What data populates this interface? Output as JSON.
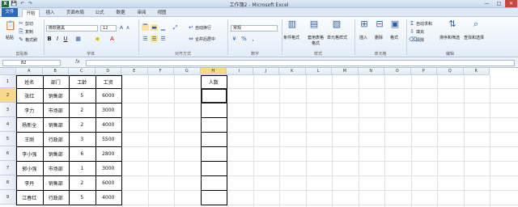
{
  "window": {
    "title": "工作簿2 - Microsoft Excel",
    "min": "—",
    "max": "□",
    "close": "✕"
  },
  "quick_access": {
    "save": "💾",
    "undo": "↶",
    "redo": "↷"
  },
  "menu": {
    "file": "文件",
    "tabs": [
      "开始",
      "插入",
      "页面布局",
      "公式",
      "数据",
      "审阅",
      "视图"
    ]
  },
  "ribbon": {
    "paste": "粘贴",
    "cut": "剪切",
    "copy": "复制",
    "format_painter": "格式刷",
    "clipboard_label": "剪贴板",
    "font_name": "微软雅黑",
    "font_size": "12",
    "bold": "B",
    "italic": "I",
    "underline": "U",
    "font_label": "字体",
    "wrap_text": "自动换行",
    "merge_center": "合并后居中",
    "alignment_label": "对齐方式",
    "number_format": "常规",
    "percent": "%",
    "comma": ",",
    "number_label": "数字",
    "conditional_format": "条件格式",
    "format_as_table": "套用表格格式",
    "cell_styles": "单元格样式",
    "styles_label": "样式",
    "insert": "插入",
    "delete": "删除",
    "format": "格式",
    "cells_label": "单元格",
    "autosum": "自动求和",
    "fill": "填充",
    "clear": "清除",
    "sort_filter": "排序和筛选",
    "find_select": "查找和选择",
    "editing_label": "编辑"
  },
  "formula_bar": {
    "name_box": "B2",
    "fx": "fx",
    "formula": ""
  },
  "sheet": {
    "columns": [
      "A",
      "B",
      "C",
      "D",
      "E",
      "F",
      "G",
      "H",
      "I",
      "J",
      "K",
      "L",
      "M",
      "N",
      "O",
      "P",
      "Q",
      "R"
    ],
    "rows": [
      "1",
      "2",
      "3",
      "4",
      "5",
      "6",
      "7",
      "8",
      "9"
    ],
    "headers": [
      "姓名",
      "部门",
      "工龄",
      "工资"
    ],
    "data": [
      [
        "张红",
        "销售部",
        "5",
        "6000"
      ],
      [
        "李力",
        "市场部",
        "2",
        "3000"
      ],
      [
        "杨新全",
        "销售部",
        "2",
        "4000"
      ],
      [
        "王刚",
        "行政部",
        "3",
        "5500"
      ],
      [
        "李小强",
        "销售部",
        "6",
        "2800"
      ],
      [
        "郭小强",
        "市场部",
        "1",
        "3000"
      ],
      [
        "李丹",
        "销售部",
        "2",
        "6000"
      ],
      [
        "江春红",
        "行政部",
        "5",
        "4000"
      ]
    ],
    "h_header": "人数"
  }
}
